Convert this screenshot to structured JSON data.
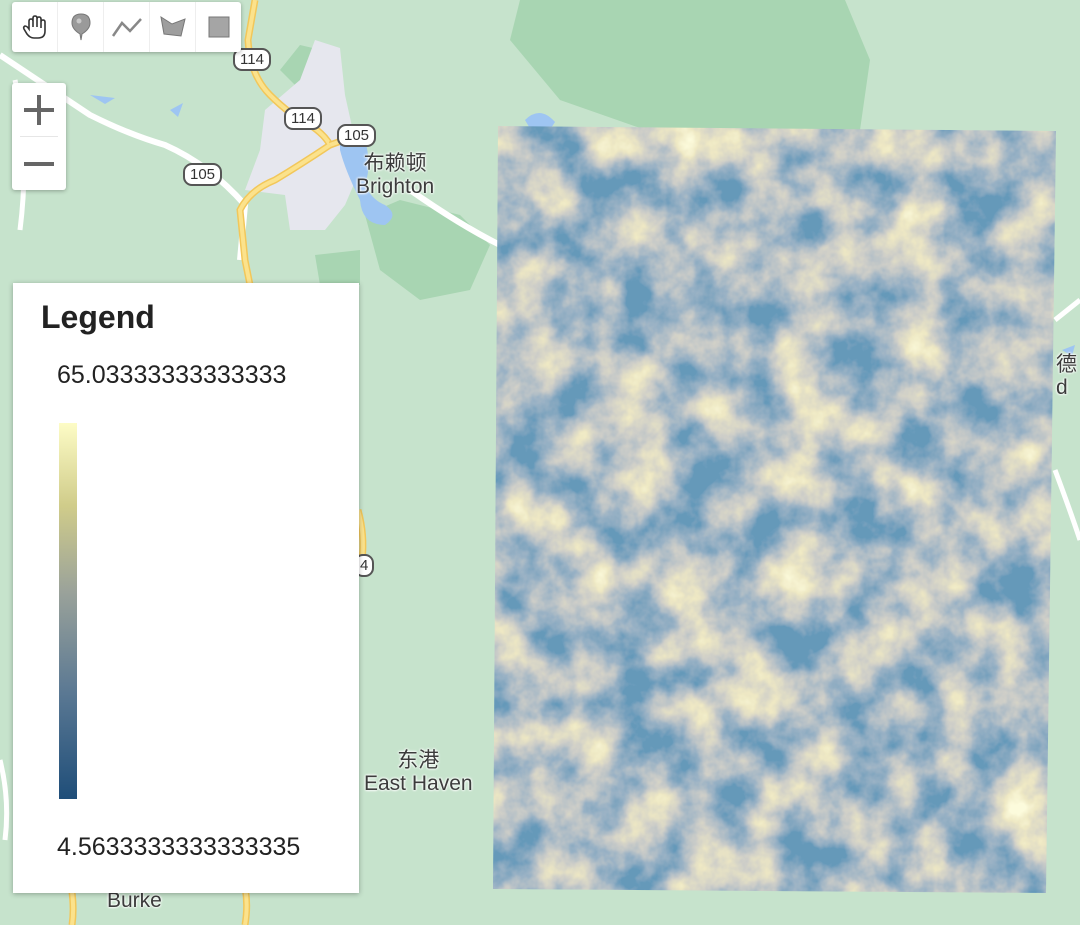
{
  "map": {
    "toolbar": {
      "tools": [
        "hand-tool",
        "marker-tool",
        "line-tool",
        "polygon-tool",
        "rectangle-tool"
      ]
    },
    "zoom": {
      "in_label": "+",
      "out_label": "−"
    },
    "road_shields": [
      "114",
      "114",
      "105",
      "105",
      "4"
    ],
    "places": {
      "brighton_cn": "布赖顿",
      "brighton_en": "Brighton",
      "easthaven_cn": "东港",
      "easthaven_en": "East Haven",
      "burke": "Burke",
      "edge_cn": "德",
      "edge_en": "d"
    },
    "legend": {
      "title": "Legend",
      "max": "65.03333333333333",
      "min": "4.5633333333333335",
      "colors": [
        "#1f4e79",
        "#fdfcc6"
      ]
    }
  }
}
